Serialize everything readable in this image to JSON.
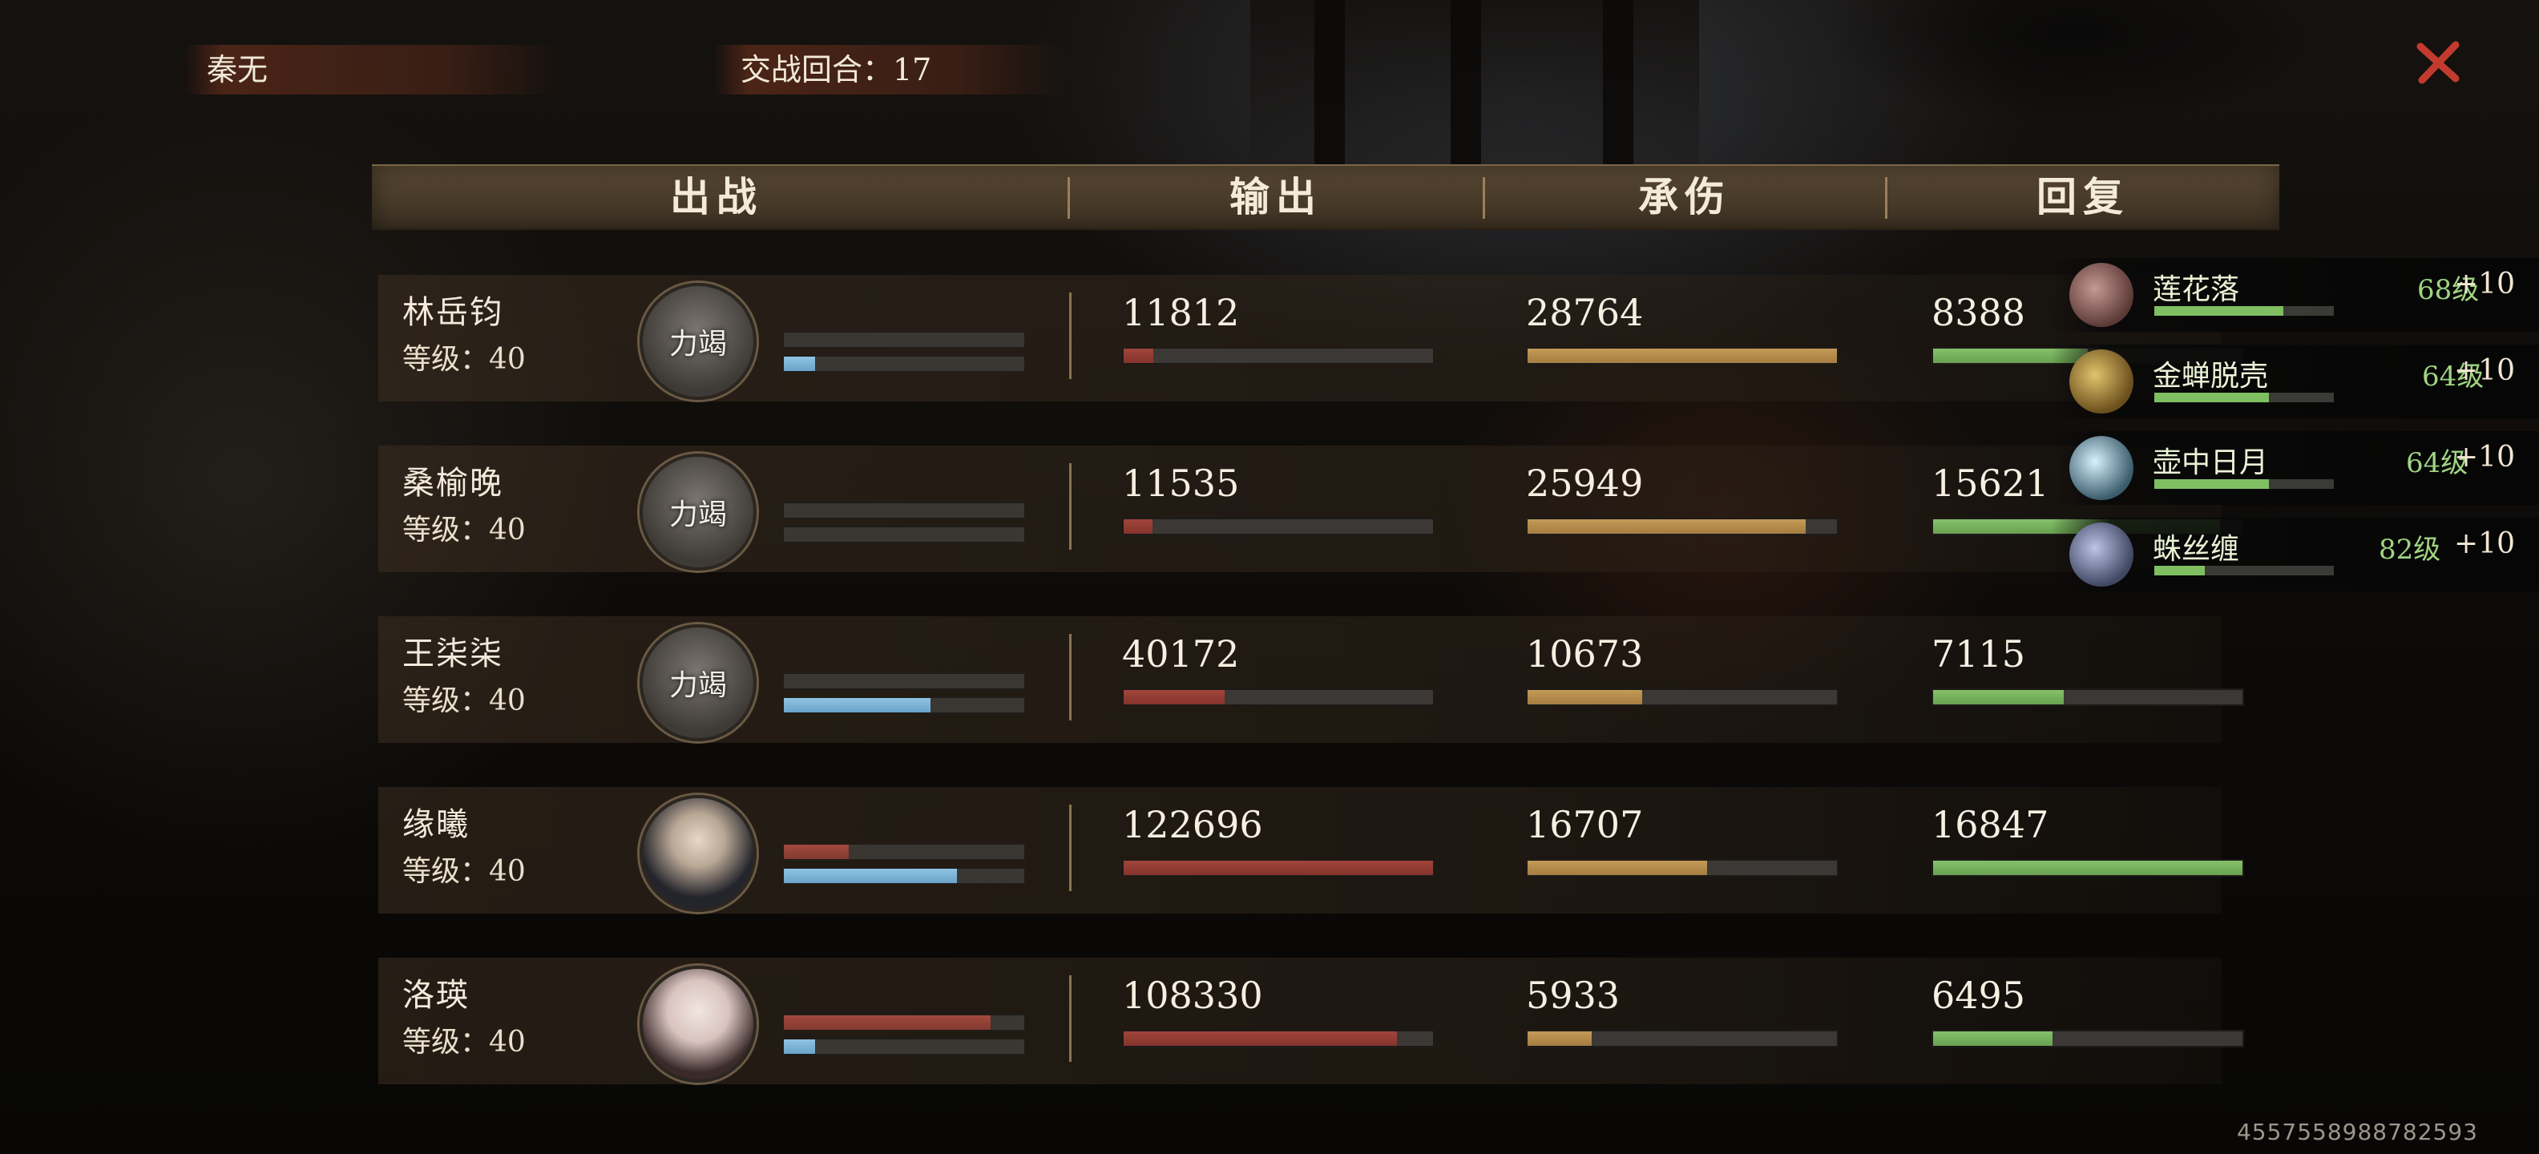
{
  "top": {
    "player_name": "秦无",
    "rounds_label": "交战回合：17",
    "close_icon": "close-x-icon",
    "close_color": "#c0392b"
  },
  "header": {
    "col_deploy": "出战",
    "col_output": "输出",
    "col_damage_taken": "承伤",
    "col_recovery": "回复"
  },
  "rows": [
    {
      "name": "林岳钧",
      "level": "等级：40",
      "avatar_text": "力竭",
      "output": "11812",
      "taken": "28764",
      "recovery": "8388",
      "output_fraction": 0.096,
      "taken_fraction": 1.0,
      "recovery_fraction": 0.5,
      "mini_top_fraction": 0.0,
      "mini_bottom_fraction": 0.13
    },
    {
      "name": "桑榆晚",
      "level": "等级：40",
      "avatar_text": "力竭",
      "output": "11535",
      "taken": "25949",
      "recovery": "15621",
      "output_fraction": 0.094,
      "taken_fraction": 0.9,
      "recovery_fraction": 0.927,
      "mini_top_fraction": 0.0,
      "mini_bottom_fraction": 0.0
    },
    {
      "name": "王柒柒",
      "level": "等级：40",
      "avatar_text": "力竭",
      "output": "40172",
      "taken": "10673",
      "recovery": "7115",
      "output_fraction": 0.327,
      "taken_fraction": 0.371,
      "recovery_fraction": 0.422,
      "mini_top_fraction": 0.0,
      "mini_bottom_fraction": 0.61
    },
    {
      "name": "缘曦",
      "level": "等级：40",
      "avatar_text": "",
      "output": "122696",
      "taken": "16707",
      "recovery": "16847",
      "output_fraction": 1.0,
      "taken_fraction": 0.581,
      "recovery_fraction": 1.0,
      "mini_top_fraction": 0.27,
      "mini_bottom_fraction": 0.72
    },
    {
      "name": "洛瑛",
      "level": "等级：40",
      "avatar_text": "",
      "output": "108330",
      "taken": "5933",
      "recovery": "6495",
      "output_fraction": 0.883,
      "taken_fraction": 0.206,
      "recovery_fraction": 0.385,
      "mini_top_fraction": 0.86,
      "mini_bottom_fraction": 0.13
    }
  ],
  "skills": [
    {
      "name": "莲花落",
      "level": "68级",
      "plus": "+10",
      "fraction": 0.72,
      "icon": "lotus-skill-icon"
    },
    {
      "name": "金蝉脱壳",
      "level": "64级",
      "plus": "+10",
      "fraction": 0.64,
      "icon": "golden-cicada-skill-icon"
    },
    {
      "name": "壶中日月",
      "level": "64级",
      "plus": "+10",
      "fraction": 0.64,
      "icon": "gourd-sun-moon-skill-icon"
    },
    {
      "name": "蛛丝缠",
      "level": "82级",
      "plus": "+10",
      "fraction": 0.28,
      "icon": "spider-silk-skill-icon"
    }
  ],
  "footer": {
    "id_text": "4557558988782593"
  }
}
